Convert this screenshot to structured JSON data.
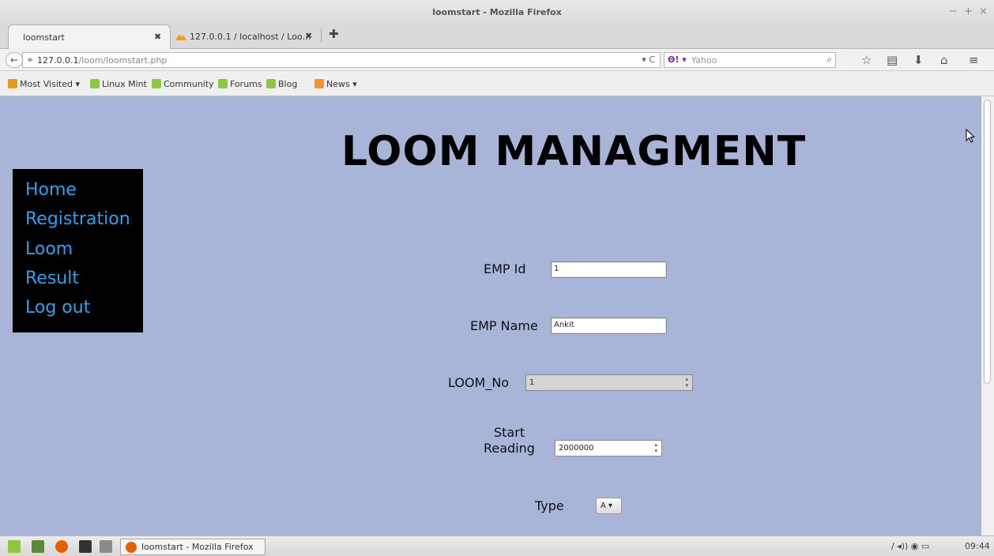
{
  "window": {
    "title": "loomstart - Mozilla Firefox",
    "controls": [
      "−",
      "+",
      "×"
    ]
  },
  "tabs": [
    {
      "label": "loomstart",
      "active": true
    },
    {
      "label": "127.0.0.1 / localhost / Loo…",
      "active": false
    }
  ],
  "tab_close_glyph": "✖",
  "new_tab_glyph": "✚",
  "navbar": {
    "back_glyph": "←",
    "url_host": "127.0.0.1",
    "url_path": "/loom/loomstart.php",
    "reload_glyph": "▾ C",
    "search_engine_label": "Θ! ▾",
    "search_placeholder": "Yahoo",
    "search_glyph": "⌕",
    "icons": [
      "bookmark-star-icon",
      "reading-list-icon",
      "downloads-icon",
      "home-icon",
      "menu-icon"
    ],
    "icon_glyphs": [
      "☆",
      "▤",
      "⬇",
      "⌂",
      "≡"
    ]
  },
  "bookmarks": [
    {
      "label": "Most Visited ▾",
      "icon": "folder"
    },
    {
      "label": "Linux Mint",
      "icon": "mint"
    },
    {
      "label": "Community",
      "icon": "mint"
    },
    {
      "label": "Forums",
      "icon": "mint"
    },
    {
      "label": "Blog",
      "icon": "mint"
    },
    {
      "label": "News ▾",
      "icon": "rss"
    }
  ],
  "page": {
    "heading": "LOOM MANAGMENT",
    "background_color": "#a9b4d9",
    "menu": [
      "Home",
      "Registration",
      "Loom",
      "Result",
      "Log out"
    ],
    "menu_link_color": "#38a0e8",
    "form": {
      "emp_id_label": "EMP Id",
      "emp_id_value": "1",
      "emp_name_label": "EMP Name",
      "emp_name_value": "Ankit",
      "loom_no_label": "LOOM_No",
      "loom_no_value": "1",
      "start_reading_label_line1": "Start",
      "start_reading_label_line2": "Reading",
      "start_reading_value": "2000000",
      "type_label": "Type",
      "type_value": "A ▾",
      "spin_glyph": "▴\n▾"
    }
  },
  "taskbar": {
    "task_label": "loomstart - Mozilla Firefox",
    "clock": "09:44",
    "tray_glyphs": "∕ ◂)) ◉ ▭"
  }
}
